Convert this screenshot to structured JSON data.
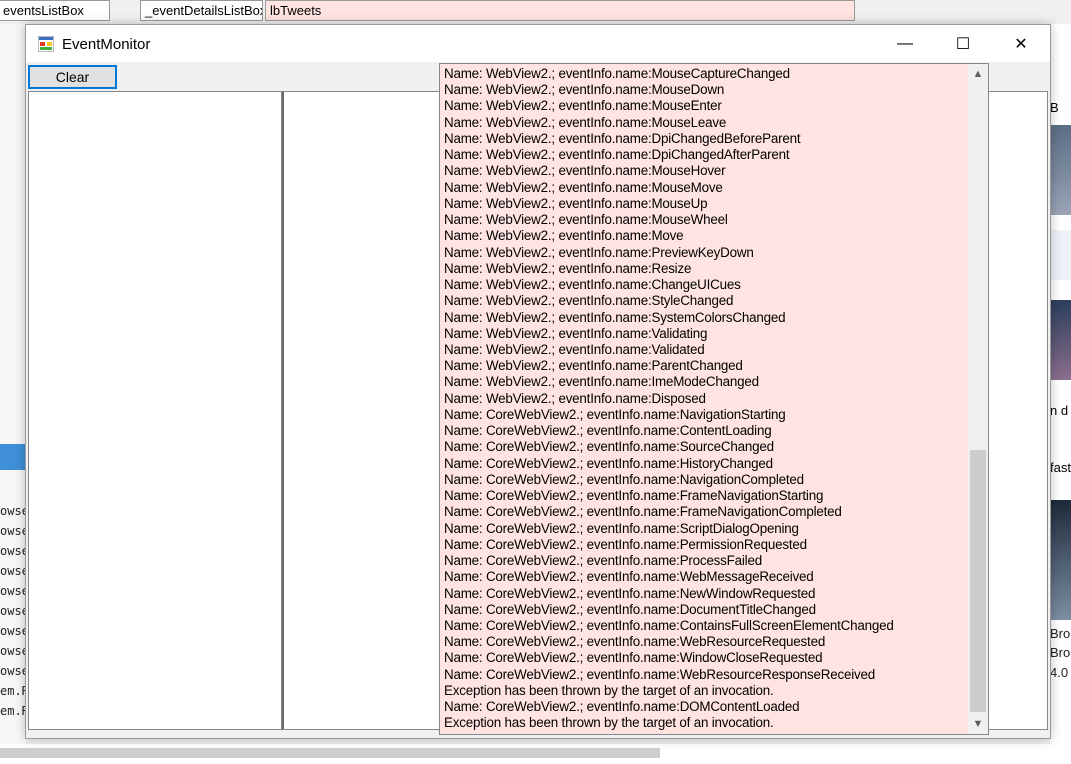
{
  "background": {
    "tabs": [
      "eventsListBox",
      "_eventDetailsListBox",
      "lbTweets"
    ],
    "code_lines": [
      "owse",
      "owse",
      "owse",
      "owse",
      "owse",
      "owse",
      "owse",
      "owse",
      "owse",
      "em.R",
      "em.R"
    ],
    "right_text": [
      "B",
      "n d",
      "fast",
      "Bro",
      "Bro",
      "4.0"
    ]
  },
  "window": {
    "title": "EventMonitor",
    "minimize_glyph": "—",
    "maximize_glyph": "☐",
    "close_glyph": "✕"
  },
  "toolbar": {
    "clear_label": "Clear"
  },
  "tweets": {
    "lines": [
      "Name: WebView2.; eventInfo.name:MouseCaptureChanged",
      "Name: WebView2.; eventInfo.name:MouseDown",
      "Name: WebView2.; eventInfo.name:MouseEnter",
      "Name: WebView2.; eventInfo.name:MouseLeave",
      "Name: WebView2.; eventInfo.name:DpiChangedBeforeParent",
      "Name: WebView2.; eventInfo.name:DpiChangedAfterParent",
      "Name: WebView2.; eventInfo.name:MouseHover",
      "Name: WebView2.; eventInfo.name:MouseMove",
      "Name: WebView2.; eventInfo.name:MouseUp",
      "Name: WebView2.; eventInfo.name:MouseWheel",
      "Name: WebView2.; eventInfo.name:Move",
      "Name: WebView2.; eventInfo.name:PreviewKeyDown",
      "Name: WebView2.; eventInfo.name:Resize",
      "Name: WebView2.; eventInfo.name:ChangeUICues",
      "Name: WebView2.; eventInfo.name:StyleChanged",
      "Name: WebView2.; eventInfo.name:SystemColorsChanged",
      "Name: WebView2.; eventInfo.name:Validating",
      "Name: WebView2.; eventInfo.name:Validated",
      "Name: WebView2.; eventInfo.name:ParentChanged",
      "Name: WebView2.; eventInfo.name:ImeModeChanged",
      "Name: WebView2.; eventInfo.name:Disposed",
      "Name: CoreWebView2.; eventInfo.name:NavigationStarting",
      "Name: CoreWebView2.; eventInfo.name:ContentLoading",
      "Name: CoreWebView2.; eventInfo.name:SourceChanged",
      "Name: CoreWebView2.; eventInfo.name:HistoryChanged",
      "Name: CoreWebView2.; eventInfo.name:NavigationCompleted",
      "Name: CoreWebView2.; eventInfo.name:FrameNavigationStarting",
      "Name: CoreWebView2.; eventInfo.name:FrameNavigationCompleted",
      "Name: CoreWebView2.; eventInfo.name:ScriptDialogOpening",
      "Name: CoreWebView2.; eventInfo.name:PermissionRequested",
      "Name: CoreWebView2.; eventInfo.name:ProcessFailed",
      "Name: CoreWebView2.; eventInfo.name:WebMessageReceived",
      "Name: CoreWebView2.; eventInfo.name:NewWindowRequested",
      "Name: CoreWebView2.; eventInfo.name:DocumentTitleChanged",
      "Name: CoreWebView2.; eventInfo.name:ContainsFullScreenElementChanged",
      "Name: CoreWebView2.; eventInfo.name:WebResourceRequested",
      "Name: CoreWebView2.; eventInfo.name:WindowCloseRequested",
      "Name: CoreWebView2.; eventInfo.name:WebResourceResponseReceived",
      "Exception has been thrown by the target of an invocation.",
      "Name: CoreWebView2.; eventInfo.name:DOMContentLoaded",
      "Exception has been thrown by the target of an invocation."
    ],
    "scroll_up_glyph": "▲",
    "scroll_down_glyph": "▼"
  }
}
